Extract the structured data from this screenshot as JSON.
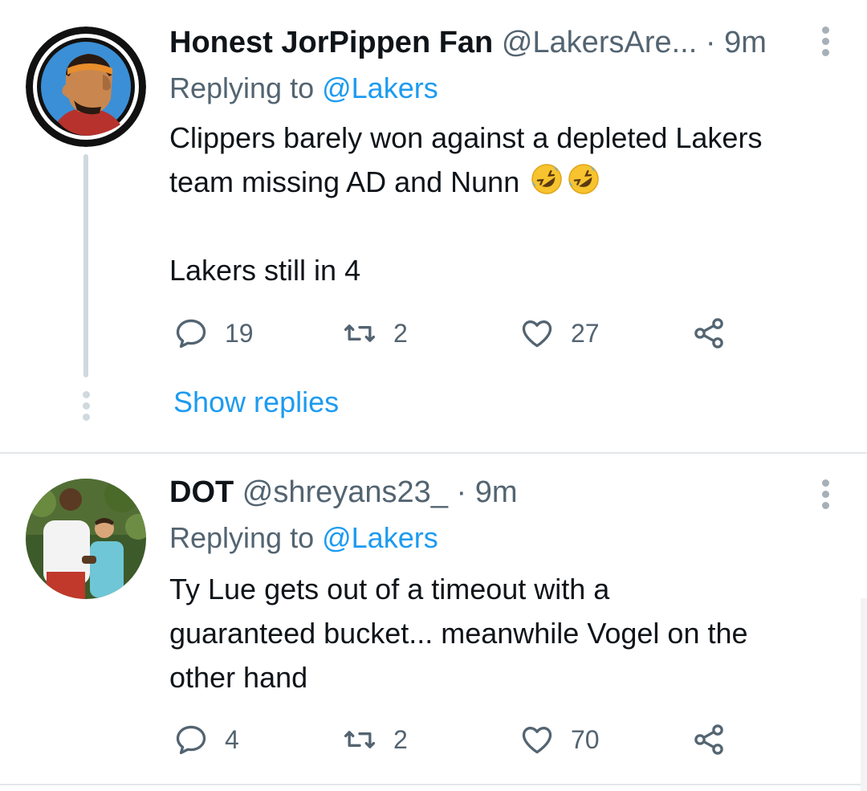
{
  "tweets": [
    {
      "name": "Honest JorPippen Fan",
      "handle": "@LakersAre...",
      "dot": "·",
      "time": "9m",
      "replying_prefix": "Replying to ",
      "replying_mention": "@Lakers",
      "body_line1": "Clippers barely won against a depleted Lakers",
      "body_line2": "team missing AD and Nunn",
      "body_line3": "Lakers still in 4",
      "emoji": [
        "rolling-on-floor-laughing-emoji",
        "rolling-on-floor-laughing-emoji"
      ],
      "replies": "19",
      "retweets": "2",
      "likes": "27",
      "show_replies": "Show replies"
    },
    {
      "name": "DOT",
      "handle": "@shreyans23_",
      "dot": "·",
      "time": "9m",
      "replying_prefix": "Replying to ",
      "replying_mention": "@Lakers",
      "body_line1": "Ty Lue gets out of a timeout with a",
      "body_line2": "guaranteed bucket... meanwhile Vogel on the",
      "body_line3": "other hand",
      "replies": "4",
      "retweets": "2",
      "likes": "70"
    }
  ],
  "colors": {
    "link": "#1d9bf0",
    "secondary_text": "#536471",
    "primary_text": "#0f1419",
    "divider": "#e4e7ea",
    "thread_line": "#cfd9de"
  },
  "icons": [
    "reply-icon",
    "retweet-icon",
    "like-icon",
    "share-icon",
    "more-icon"
  ]
}
